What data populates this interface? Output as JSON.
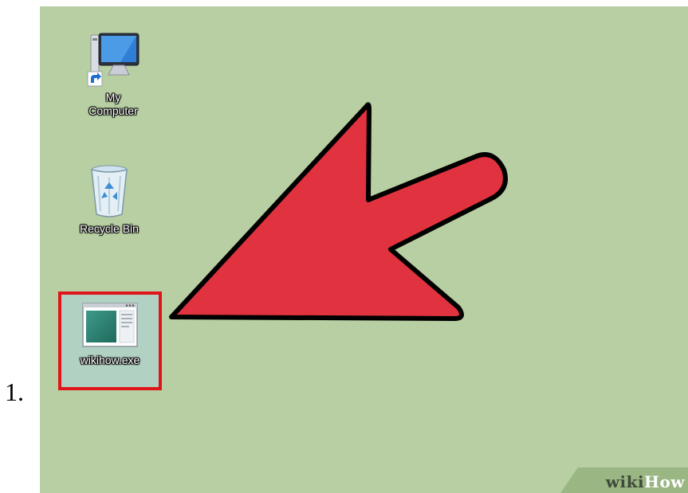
{
  "step_number": "1.",
  "desktop": {
    "background_color": "#b7cfa2",
    "icons": [
      {
        "label": "My\nComputer",
        "icon": "computer-icon"
      },
      {
        "label": "Recycle Bin",
        "icon": "recycle-bin-icon"
      },
      {
        "label": "wikihow.exe",
        "icon": "application-window-icon",
        "highlighted": true,
        "highlight_color": "#e0151b"
      }
    ]
  },
  "annotation": {
    "type": "arrow",
    "color": "#e0323f",
    "outline": "#000000",
    "points_to": "wikihow.exe"
  },
  "watermark": {
    "wiki": "wiki",
    "how": "How"
  }
}
